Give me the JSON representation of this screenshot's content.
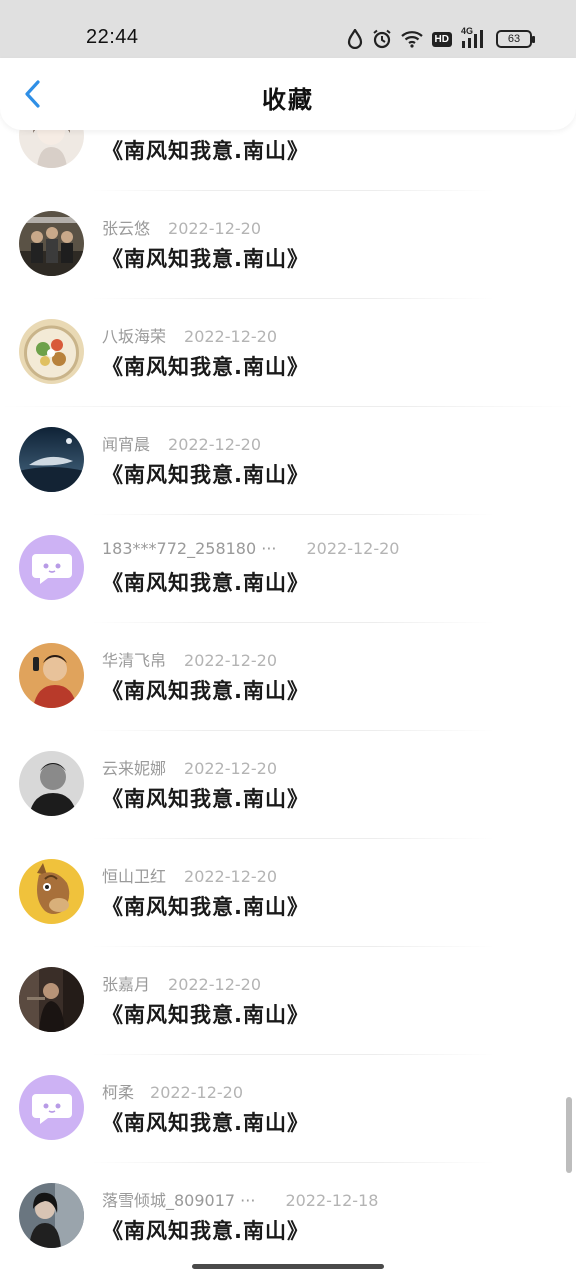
{
  "status_bar": {
    "time": "22:44",
    "battery": "63",
    "network": "4G",
    "hd": "HD"
  },
  "nav": {
    "title": "收藏"
  },
  "items": [
    {
      "user": "",
      "date": "",
      "title": "《南风知我意.南山》",
      "avatar": "girl-illustration-avatar",
      "avatar_color": "#e9e2da"
    },
    {
      "user": "张云悠",
      "date": "2022-12-20",
      "title": "《南风知我意.南山》",
      "avatar": "group-photo-avatar",
      "avatar_color": "#4a4438"
    },
    {
      "user": "八坂海荣",
      "date": "2022-12-20",
      "title": "《南风知我意.南山》",
      "avatar": "food-bowl-avatar",
      "avatar_color": "#d8b26a"
    },
    {
      "user": "闻宵晨",
      "date": "2022-12-20",
      "title": "《南风知我意.南山》",
      "avatar": "night-sky-whale-avatar",
      "avatar_color": "#1e3146"
    },
    {
      "user": "183***772_258180 ···",
      "date": "2022-12-20",
      "title": "《南风知我意.南山》",
      "avatar": "default-chat-avatar",
      "avatar_color": "#cdb2f4"
    },
    {
      "user": "华清飞帛",
      "date": "2022-12-20",
      "title": "《南风知我意.南山》",
      "avatar": "man-phone-avatar",
      "avatar_color": "#d9944e"
    },
    {
      "user": "云来妮娜",
      "date": "2022-12-20",
      "title": "《南风知我意.南山》",
      "avatar": "man-portrait-bw-avatar",
      "avatar_color": "#3a3a3a"
    },
    {
      "user": "恒山卫红",
      "date": "2022-12-20",
      "title": "《南风知我意.南山》",
      "avatar": "cartoon-horse-avatar",
      "avatar_color": "#e8b83a"
    },
    {
      "user": "张嘉月",
      "date": "2022-12-20",
      "title": "《南风知我意.南山》",
      "avatar": "dark-scene-avatar",
      "avatar_color": "#3b2f2a"
    },
    {
      "user": "柯柔",
      "date": "2022-12-20",
      "title": "《南风知我意.南山》",
      "avatar": "default-chat-avatar",
      "avatar_color": "#cdb2f4"
    },
    {
      "user": "落雪倾城_809017 ···",
      "date": "2022-12-18",
      "title": "《南风知我意.南山》",
      "avatar": "girl-mirror-avatar",
      "avatar_color": "#4a5560"
    }
  ]
}
